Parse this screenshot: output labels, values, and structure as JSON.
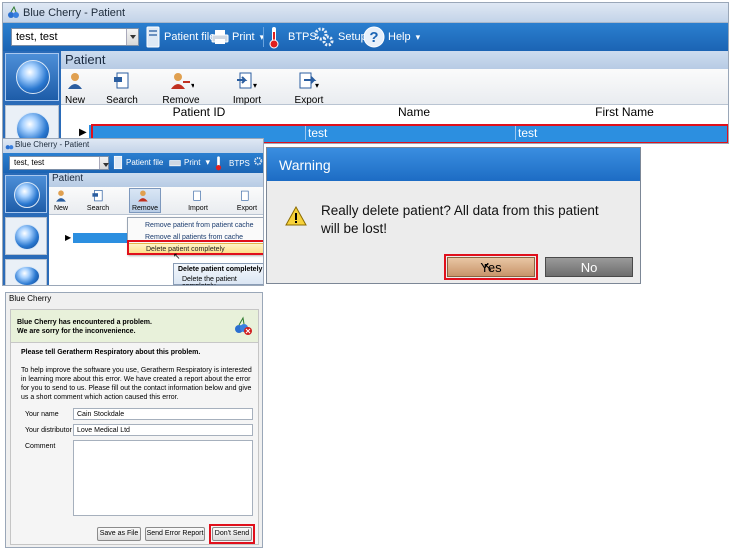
{
  "main_window": {
    "title": "Blue Cherry - Patient",
    "patient_combo_value": "test, test",
    "toolbar": {
      "patient_file": "Patient file",
      "print": "Print",
      "btps": "BTPS",
      "setup": "Setup",
      "help": "Help"
    },
    "panel_title": "Patient",
    "ribbon": {
      "new": "New",
      "search": "Search",
      "remove": "Remove",
      "import": "Import",
      "export": "Export"
    },
    "grid": {
      "columns": [
        "Patient ID",
        "Name",
        "First Name"
      ],
      "selected_row": {
        "patient_id": "",
        "name": "test",
        "first_name": "test"
      }
    }
  },
  "context_window": {
    "title": "Blue Cherry - Patient",
    "patient_combo_value": "test, test",
    "toolbar": {
      "patient_file": "Patient file",
      "print": "Print",
      "btps": "BTPS"
    },
    "panel_title": "Patient",
    "ribbon": {
      "new": "New",
      "search": "Search",
      "remove": "Remove",
      "import": "Import",
      "export": "Export"
    },
    "menu": {
      "items": [
        "Remove patient from patient cache",
        "Remove all patients from cache",
        "Delete patient completely"
      ]
    },
    "tooltip": {
      "title": "Delete patient completely",
      "body": "Delete the patient completely"
    }
  },
  "warning_dialog": {
    "title": "Warning",
    "message": "Really delete patient? All data from this patient will be lost!",
    "yes_label": "Yes",
    "no_label": "No"
  },
  "error_dialog": {
    "title": "Blue Cherry",
    "heading_line1": "Blue Cherry has encountered a problem.",
    "heading_line2": "We are sorry for the inconvenience.",
    "subheading": "Please tell Geratherm Respiratory about this problem.",
    "description": "To help improve the software you use, Geratherm Respiratory is interested in learning more about this error. We have created a report about the error for you to send to us. Please fill out the contact information below and give us a short comment which action caused this error.",
    "name_label": "Your name",
    "name_value": "Cain Stockdale",
    "distributor_label": "Your distributor",
    "distributor_value": "Love Medical Ltd",
    "comment_label": "Comment",
    "comment_value": "",
    "save_button": "Save as File",
    "send_button": "Send Error Report",
    "dont_send_button": "Don't Send"
  },
  "colors": {
    "accent_blue": "#1b64b4",
    "highlight_red": "#e0101c",
    "selection_blue": "#2c8fe0"
  }
}
